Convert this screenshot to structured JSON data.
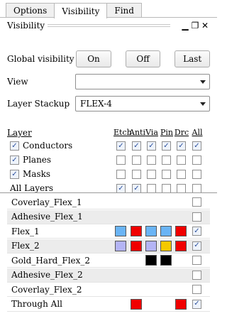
{
  "tabs": [
    "Options",
    "Visibility",
    "Find"
  ],
  "panel": {
    "title": "Visibility",
    "min_icon": "minimize-icon",
    "float_icon": "float-icon",
    "close_icon": "close-icon"
  },
  "global_visibility": {
    "label": "Global visibility",
    "on": "On",
    "off": "Off",
    "last": "Last"
  },
  "view": {
    "label": "View",
    "value": ""
  },
  "layer_stackup": {
    "label": "Layer Stackup",
    "value": "FLEX-4"
  },
  "columns": [
    "Etch",
    "Anti",
    "Via",
    "Pin",
    "Drc",
    "All"
  ],
  "layer_header": "Layer",
  "categories": [
    {
      "label": "Conductors",
      "checked": true,
      "cols": [
        true,
        true,
        true,
        true,
        true,
        true
      ]
    },
    {
      "label": "Planes",
      "checked": true,
      "cols": [
        false,
        false,
        false,
        false,
        false,
        false
      ]
    },
    {
      "label": "Masks",
      "checked": true,
      "cols": [
        false,
        false,
        false,
        false,
        false,
        false
      ]
    },
    {
      "label": "All Layers",
      "cols": [
        true,
        true,
        false,
        false,
        false,
        false
      ]
    }
  ],
  "layers": [
    {
      "name": "Coverlay_Flex_1",
      "shaded": false,
      "swatches": [],
      "all": false
    },
    {
      "name": "Adhesive_Flex_1",
      "shaded": true,
      "swatches": [],
      "all": false
    },
    {
      "name": "Flex_1",
      "shaded": false,
      "swatches": [
        "#6ab4f5",
        "#f00000",
        "#6ab4f5",
        "#6ab4f5",
        "#f00000"
      ],
      "all": true
    },
    {
      "name": "Flex_2",
      "shaded": true,
      "swatches": [
        "#b4b4f5",
        "#f00000",
        "#b4b4f5",
        "#f5c800",
        "#f00000"
      ],
      "all": true
    },
    {
      "name": "Gold_Hard_Flex_2",
      "shaded": false,
      "swatches": [
        "",
        "",
        "#000000",
        "#000000",
        ""
      ],
      "all": false
    },
    {
      "name": "Adhesive_Flex_2",
      "shaded": true,
      "swatches": [],
      "all": false
    },
    {
      "name": "Coverlay_Flex_2",
      "shaded": false,
      "swatches": [],
      "all": false
    },
    {
      "name": "Through All",
      "shaded": false,
      "swatches": [
        "",
        "#f00000",
        "",
        "",
        "#f00000"
      ],
      "all": true
    }
  ]
}
